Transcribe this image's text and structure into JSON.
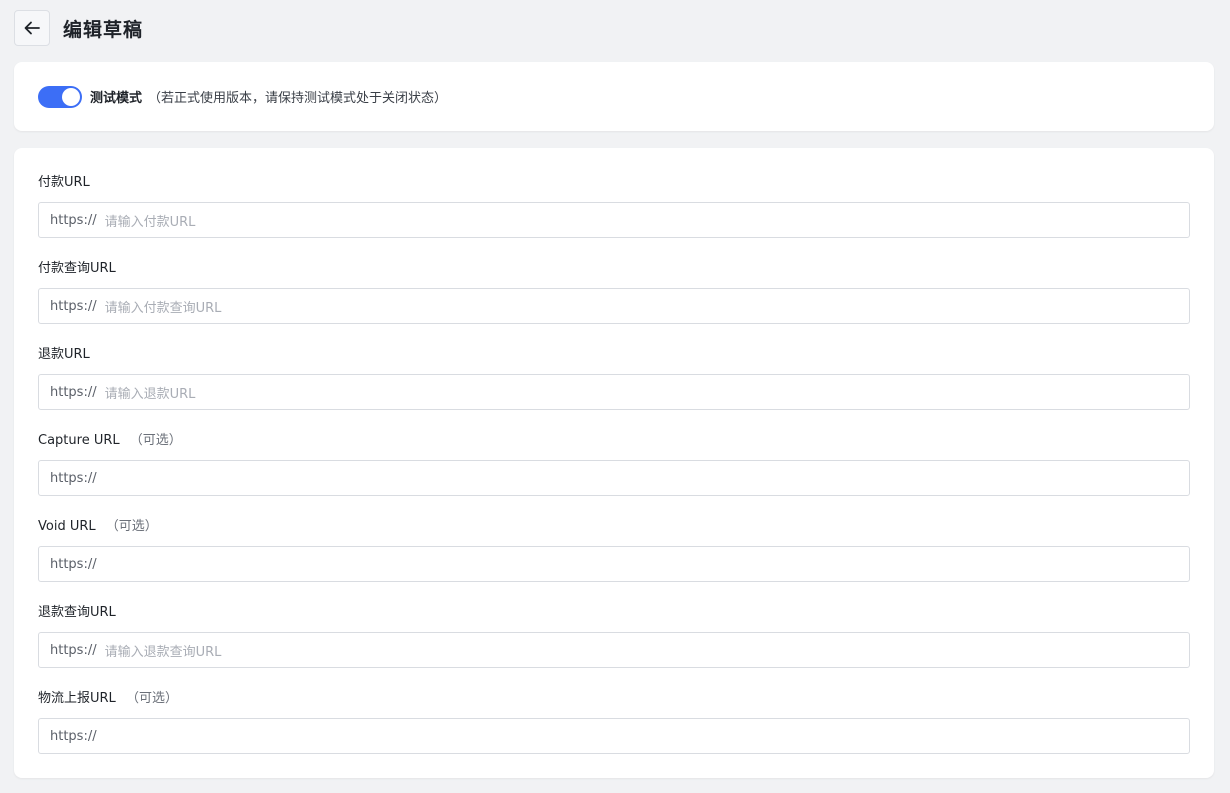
{
  "header": {
    "title": "编辑草稿"
  },
  "test_mode": {
    "label": "测试模式",
    "hint": "（若正式使用版本，请保持测试模式处于关闭状态）",
    "enabled": true,
    "accent": "#3c6ef6"
  },
  "fields": [
    {
      "label": "付款URL",
      "optional": "",
      "prefix": "https://",
      "placeholder": "请输入付款URL"
    },
    {
      "label": "付款查询URL",
      "optional": "",
      "prefix": "https://",
      "placeholder": "请输入付款查询URL"
    },
    {
      "label": "退款URL",
      "optional": "",
      "prefix": "https://",
      "placeholder": "请输入退款URL"
    },
    {
      "label": "Capture URL",
      "optional": "（可选）",
      "prefix": "https://",
      "placeholder": ""
    },
    {
      "label": "Void URL",
      "optional": "（可选）",
      "prefix": "https://",
      "placeholder": ""
    },
    {
      "label": "退款查询URL",
      "optional": "",
      "prefix": "https://",
      "placeholder": "请输入退款查询URL"
    },
    {
      "label": "物流上报URL",
      "optional": "（可选）",
      "prefix": "https://",
      "placeholder": ""
    }
  ]
}
